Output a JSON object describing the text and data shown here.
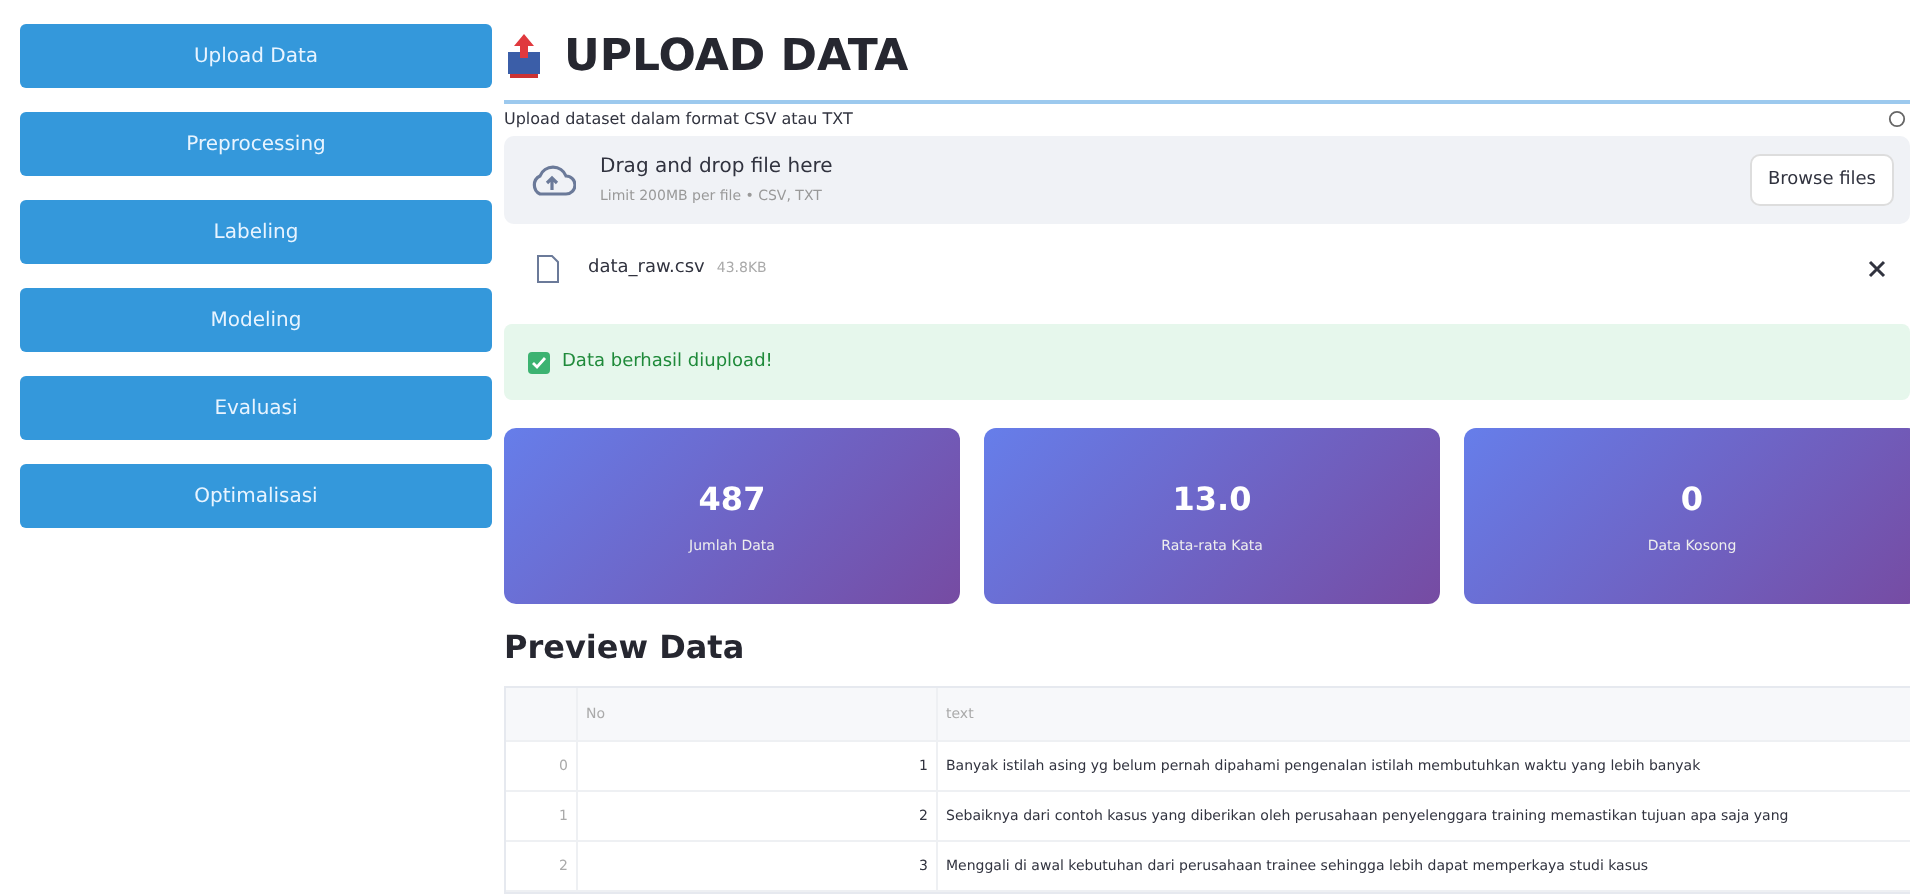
{
  "sidebar": {
    "items": [
      {
        "label": "Upload Data"
      },
      {
        "label": "Preprocessing"
      },
      {
        "label": "Labeling"
      },
      {
        "label": "Modeling"
      },
      {
        "label": "Evaluasi"
      },
      {
        "label": "Optimalisasi"
      }
    ]
  },
  "header": {
    "title": "UPLOAD DATA"
  },
  "uploader": {
    "label": "Upload dataset dalam format CSV atau TXT",
    "dropzone_title": "Drag and drop file here",
    "dropzone_hint": "Limit 200MB per file • CSV, TXT",
    "browse_button": "Browse files"
  },
  "file": {
    "name": "data_raw.csv",
    "size": "43.8KB"
  },
  "alert": {
    "message": "Data berhasil diupload!"
  },
  "metrics": [
    {
      "value": "487",
      "label": "Jumlah Data"
    },
    {
      "value": "13.0",
      "label": "Rata-rata Kata"
    },
    {
      "value": "0",
      "label": "Data Kosong"
    }
  ],
  "preview": {
    "title": "Preview Data",
    "columns": [
      "No",
      "text"
    ],
    "rows": [
      {
        "index": "0",
        "no": "1",
        "text": "Banyak istilah asing yg belum pernah dipahami pengenalan istilah membutuhkan waktu yang lebih banyak"
      },
      {
        "index": "1",
        "no": "2",
        "text": "Sebaiknya dari contoh kasus yang diberikan oleh perusahaan penyelenggara training memastikan tujuan apa saja yang"
      },
      {
        "index": "2",
        "no": "3",
        "text": "Menggali di awal kebutuhan dari perusahaan trainee sehingga lebih dapat memperkaya studi kasus"
      }
    ]
  }
}
